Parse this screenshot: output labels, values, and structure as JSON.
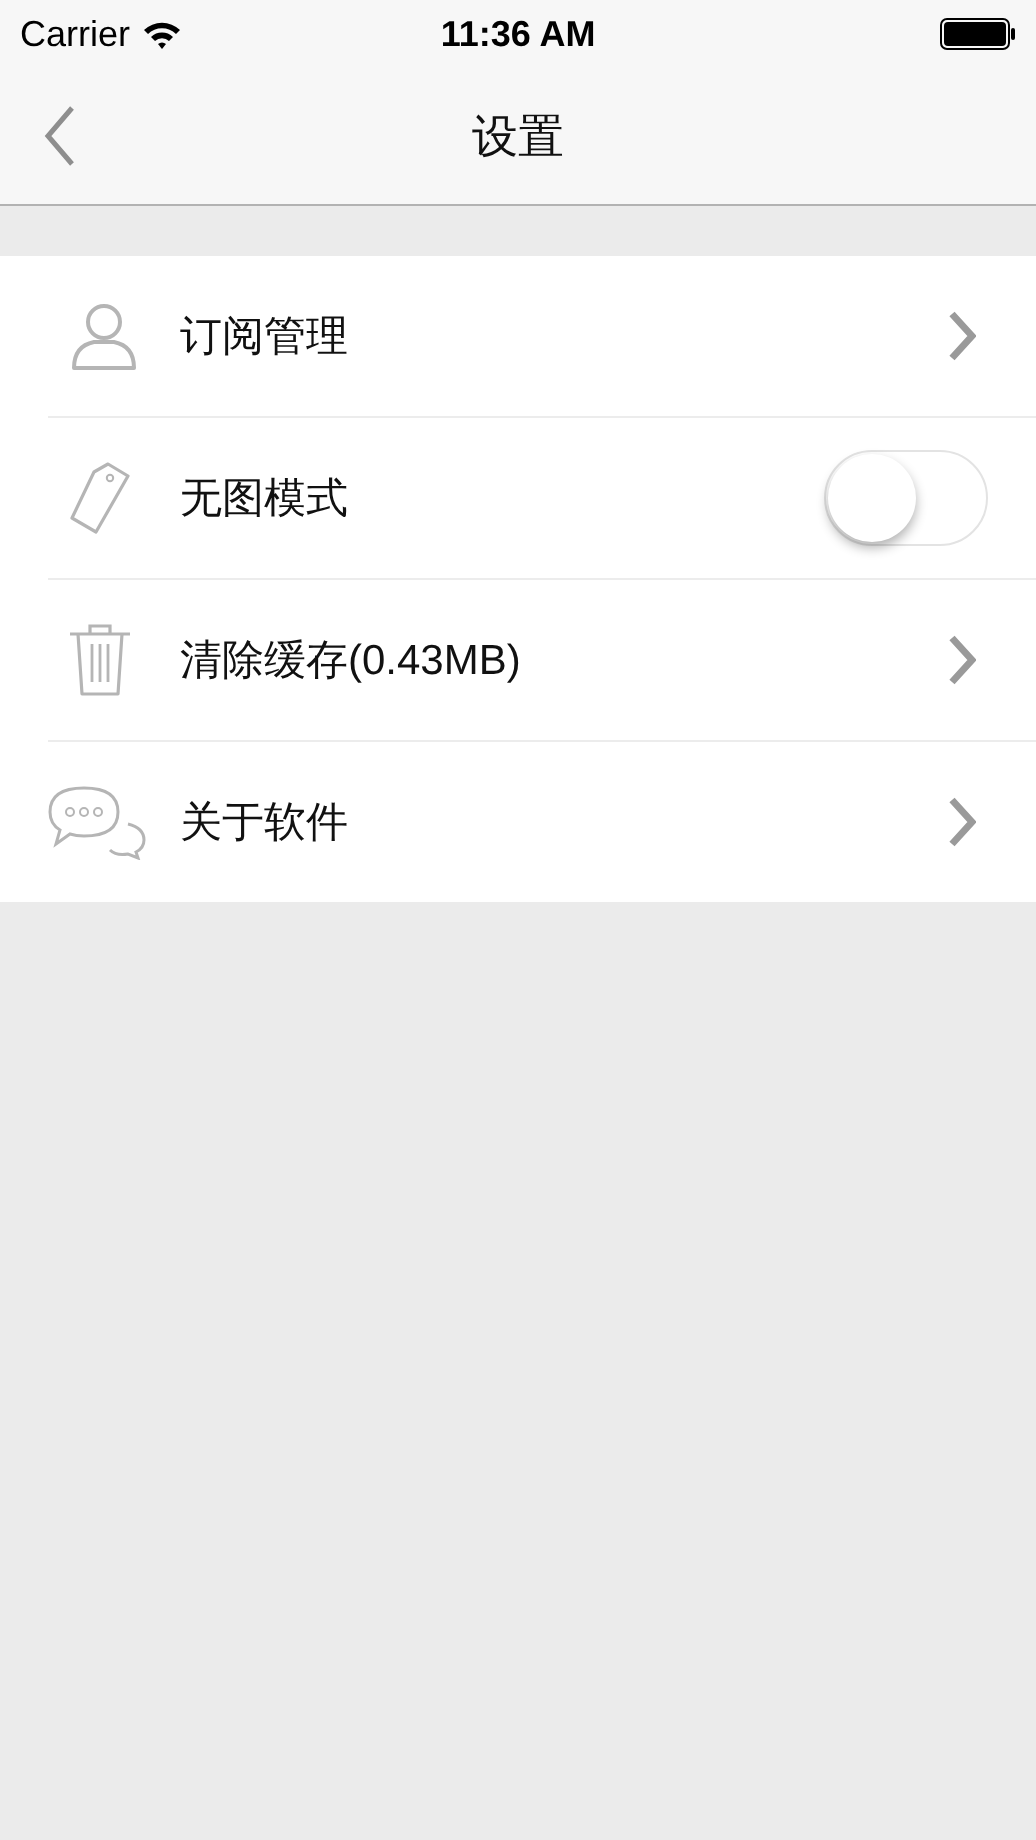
{
  "status_bar": {
    "carrier": "Carrier",
    "time": "11:36 AM"
  },
  "nav_bar": {
    "title": "设置"
  },
  "settings": [
    {
      "label": "订阅管理",
      "kind": "link"
    },
    {
      "label": "无图模式",
      "kind": "switch",
      "on": false
    },
    {
      "label": "清除缓存(0.43MB)",
      "kind": "link"
    },
    {
      "label": "关于软件",
      "kind": "link"
    }
  ]
}
